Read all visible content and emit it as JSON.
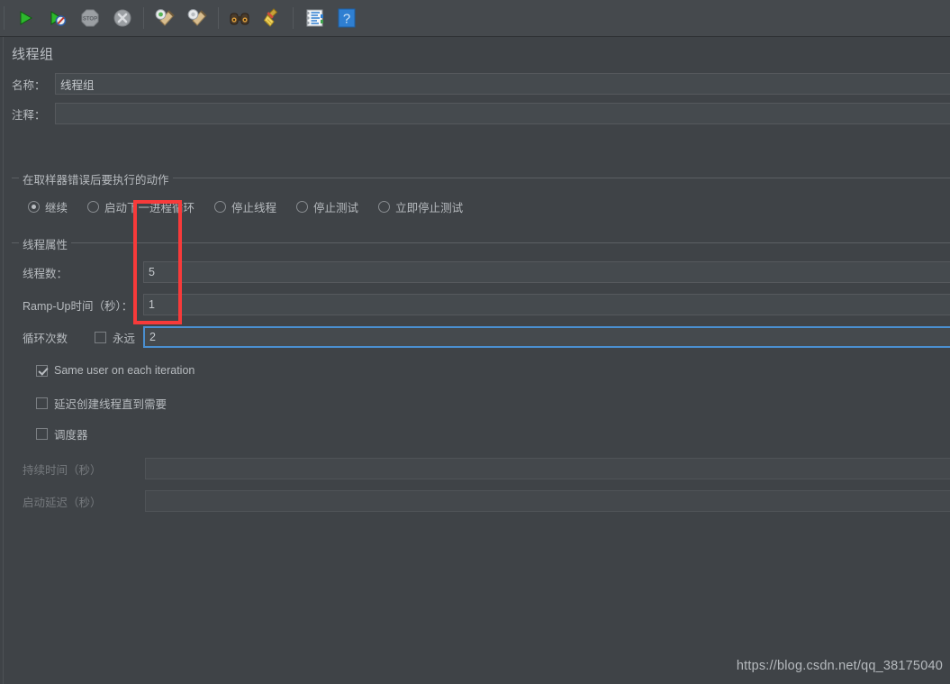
{
  "window": {
    "title": "线程组",
    "background": "#3f4347",
    "accent": "#4a8fd0",
    "annotation_color": "#f73a3a"
  },
  "toolbar": {
    "buttons": [
      {
        "name": "start-button",
        "icon": "play-icon",
        "tooltip": "Start"
      },
      {
        "name": "start-no-timers-button",
        "icon": "play-no-timers-icon",
        "tooltip": "Start no pauses"
      },
      {
        "name": "stop-button",
        "icon": "stop-icon",
        "tooltip": "Stop",
        "label": "STOP"
      },
      {
        "name": "shutdown-button",
        "icon": "shutdown-x-icon",
        "tooltip": "Shutdown"
      },
      {
        "name": "clear-button",
        "icon": "gear-broom-green-icon",
        "tooltip": "Clear"
      },
      {
        "name": "clear-all-button",
        "icon": "gear-broom-icon",
        "tooltip": "Clear All"
      },
      {
        "name": "search-button",
        "icon": "binoculars-icon",
        "tooltip": "Search"
      },
      {
        "name": "reset-search-button",
        "icon": "broom-icon",
        "tooltip": "Reset Search"
      },
      {
        "name": "function-helper-button",
        "icon": "notepad-list-icon",
        "tooltip": "Function Helper Dialog"
      },
      {
        "name": "help-button",
        "icon": "help-question-icon",
        "label": "?",
        "tooltip": "Help"
      }
    ]
  },
  "form": {
    "name_label": "名称：",
    "name_value": "线程组",
    "comment_label": "注释：",
    "comment_value": "",
    "comment_placeholder": ""
  },
  "on_sampler_error": {
    "group_title": "在取样器错误后要执行的动作",
    "options": [
      {
        "label": "继续",
        "checked": true
      },
      {
        "label": "启动下一进程循环",
        "checked": false
      },
      {
        "label": "停止线程",
        "checked": false
      },
      {
        "label": "停止测试",
        "checked": false
      },
      {
        "label": "立即停止测试",
        "checked": false
      }
    ]
  },
  "thread_properties": {
    "group_title": "线程属性",
    "threads_label": "线程数：",
    "threads_value": "5",
    "rampup_label": "Ramp-Up时间（秒）：",
    "rampup_value": "1",
    "loop_label": "循环次数",
    "forever_label": "永远",
    "forever_checked": false,
    "loop_value": "2",
    "same_user_label": "Same user on each iteration",
    "same_user_checked": true,
    "delayed_start_label": "延迟创建线程直到需要",
    "delayed_start_checked": false,
    "scheduler_label": "调度器",
    "scheduler_checked": false,
    "duration_label": "持续时间（秒）",
    "duration_value": "",
    "duration_enabled": false,
    "startup_delay_label": "启动延迟（秒）",
    "startup_delay_value": "",
    "startup_delay_enabled": false
  },
  "watermark": {
    "text": "https://blog.csdn.net/qq_38175040"
  }
}
